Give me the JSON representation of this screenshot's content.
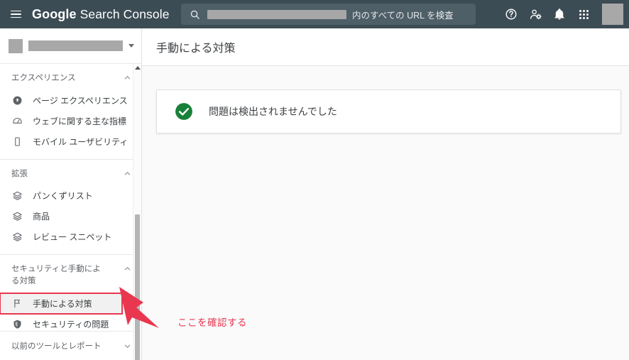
{
  "header": {
    "menu_icon": "hamburger-menu-icon",
    "brand_google": "Google",
    "brand_product": "Search Console",
    "search": {
      "icon": "search-icon",
      "redacted_value": "",
      "suffix_text": "内のすべての URL を検査",
      "placeholder": "内のすべての URL を検査"
    },
    "icons": [
      {
        "name": "help-icon",
        "label": "ヘルプ"
      },
      {
        "name": "account-settings-icon",
        "label": "アカウント設定"
      },
      {
        "name": "notifications-bell-icon",
        "label": "通知"
      },
      {
        "name": "apps-grid-icon",
        "label": "Google アプリ"
      }
    ],
    "avatar": "avatar"
  },
  "sidebar": {
    "property_selector": {
      "name": "property-selector",
      "redacted": true,
      "chevron": "chevron-down-icon"
    },
    "sections": [
      {
        "id": "experience",
        "label": "エクスペリエンス",
        "expanded": true,
        "chevron": "chevron-up-icon",
        "items": [
          {
            "label": "ページ エクスペリエンス",
            "icon": "page-experience-icon"
          },
          {
            "label": "ウェブに関する主な指標",
            "icon": "speedometer-icon"
          },
          {
            "label": "モバイル ユーザビリティ",
            "icon": "mobile-phone-icon"
          }
        ]
      },
      {
        "id": "enhancements",
        "label": "拡張",
        "expanded": true,
        "chevron": "chevron-up-icon",
        "items": [
          {
            "label": "パンくずリスト",
            "icon": "layers-icon"
          },
          {
            "label": "商品",
            "icon": "layers-icon"
          },
          {
            "label": "レビュー スニペット",
            "icon": "layers-icon"
          }
        ]
      },
      {
        "id": "security-and-manual-actions",
        "label": "セキュリティと手動による対策",
        "expanded": true,
        "chevron": "chevron-up-icon",
        "items": [
          {
            "label": "手動による対策",
            "icon": "flag-icon",
            "selected": true,
            "highlighted": true
          },
          {
            "label": "セキュリティの問題",
            "icon": "shield-icon"
          }
        ]
      }
    ],
    "legacy": {
      "label": "以前のツールとレポート",
      "chevron": "chevron-down-icon",
      "expanded": false
    },
    "scrollbar": {
      "name": "sidebar-scrollbar",
      "up_arrow": "scroll-up-arrow-icon"
    }
  },
  "main": {
    "page_title": "手動による対策",
    "status_card": {
      "icon": "green-check-circle-icon",
      "message": "問題は検出されませんでした"
    }
  },
  "annotation": {
    "arrow": "red-arrow-icon",
    "text": "ここを確認する"
  },
  "colors": {
    "header_bg": "#3c4c55",
    "search_bg": "#4e5f68",
    "accent_red": "#e8374f",
    "success_green": "#188038",
    "content_bg": "#fafafa",
    "redact_gray": "#a8a8a8"
  }
}
